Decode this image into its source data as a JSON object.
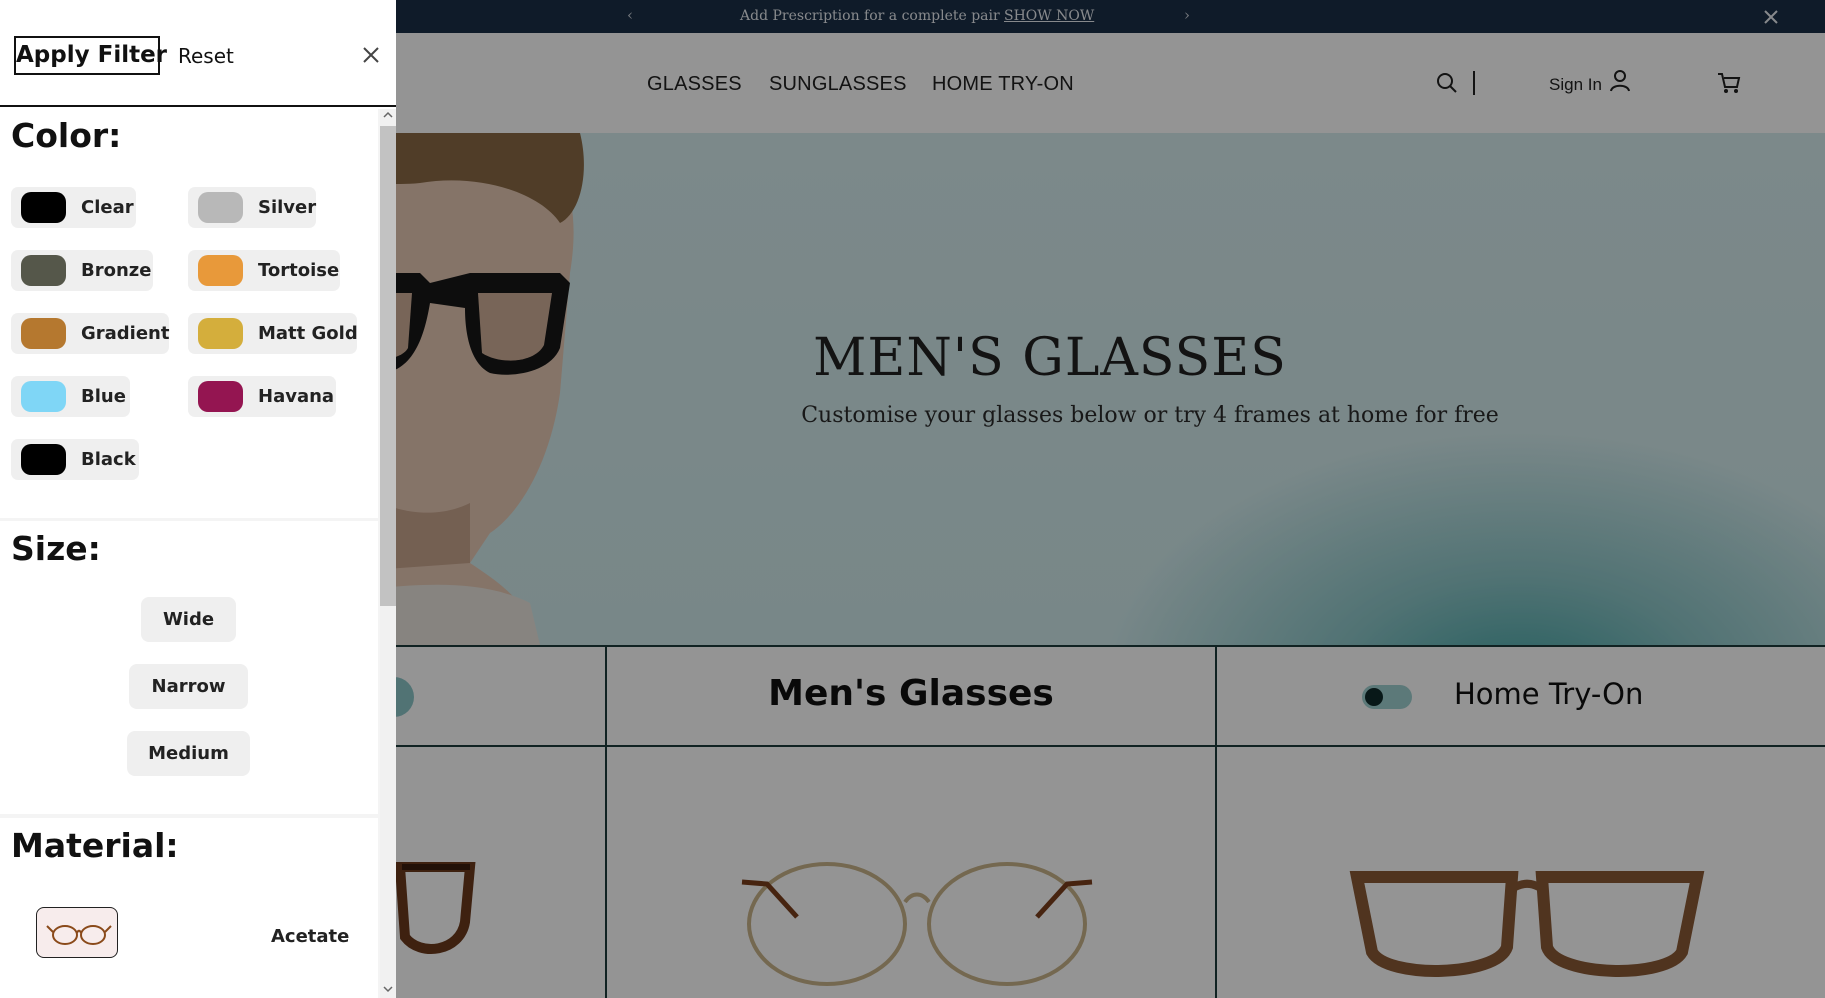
{
  "announcement": {
    "message": "Add Prescription for a complete pair",
    "link_label": "SHOW NOW",
    "prev_icon": "chevron-left-icon",
    "next_icon": "chevron-right-icon",
    "close_icon": "close-icon"
  },
  "header": {
    "nav": [
      "GLASSES",
      "SUNGLASSES",
      "HOME TRY-ON"
    ],
    "sign_in_label": "Sign In",
    "icons": [
      "search-icon",
      "user-icon",
      "cart-icon"
    ]
  },
  "hero": {
    "title": "MEN'S GLASSES",
    "subtitle": "Customise your glasses below or try 4 frames at home for free"
  },
  "tabs": {
    "center_title": "Men's Glasses",
    "home_try_on_label": "Home Try-On",
    "home_try_on_enabled": true
  },
  "filter_panel": {
    "apply_label": "Apply Filter",
    "reset_label": "Reset",
    "close_icon": "close-icon",
    "color": {
      "title": "Color:",
      "options": [
        {
          "label": "Clear",
          "swatch": "#000000"
        },
        {
          "label": "Silver",
          "swatch": "#b8b8b8"
        },
        {
          "label": "Bronze",
          "swatch": "#55574a"
        },
        {
          "label": "Tortoise",
          "swatch": "#e8993a"
        },
        {
          "label": "Gradient",
          "swatch": "#b5782f"
        },
        {
          "label": "Matt Gold",
          "swatch": "#d4ae3c"
        },
        {
          "label": "Blue",
          "swatch": "#7fd6f6"
        },
        {
          "label": "Havana",
          "swatch": "#941551"
        },
        {
          "label": "Black",
          "swatch": "#000000"
        }
      ]
    },
    "size": {
      "title": "Size:",
      "options": [
        "Wide",
        "Narrow",
        "Medium"
      ]
    },
    "material": {
      "title": "Material:",
      "options": [
        {
          "label": "Acetate",
          "icon": "glasses-thumbnail-icon"
        }
      ]
    }
  }
}
